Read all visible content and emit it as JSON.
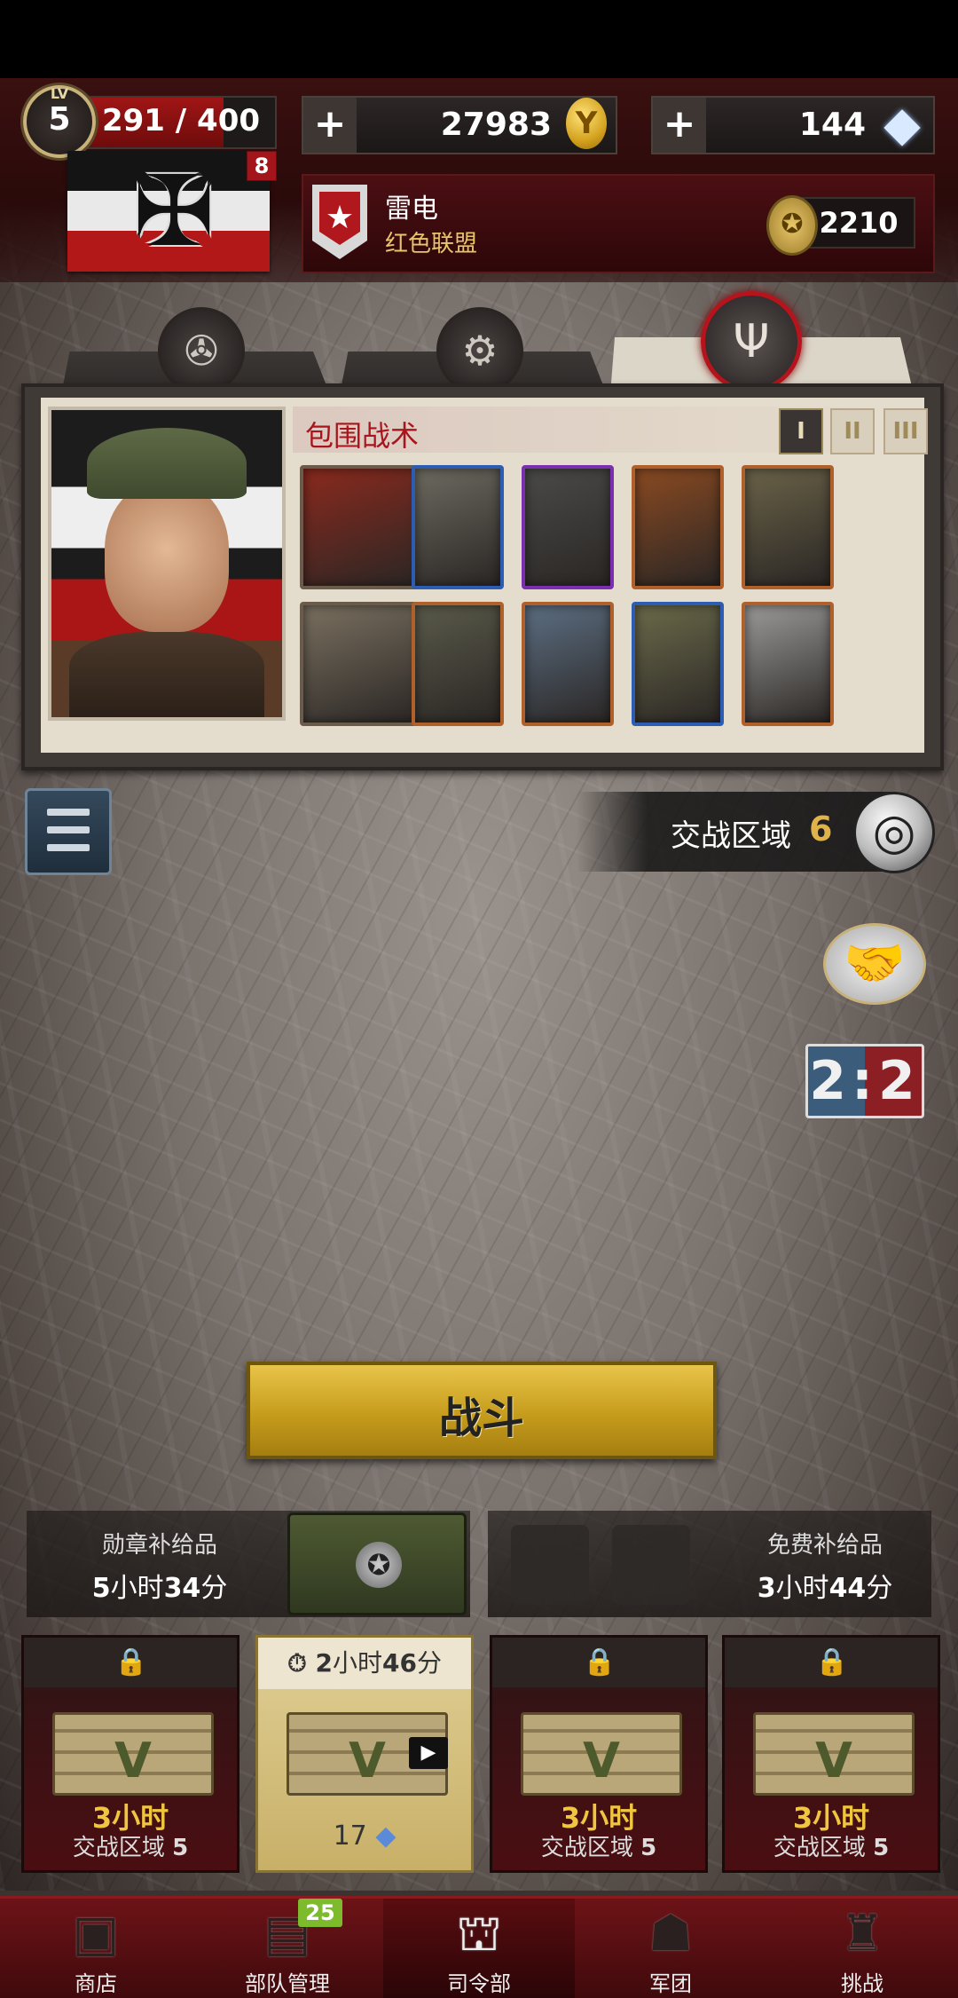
{
  "player": {
    "level_prefix": "LV",
    "level": "5",
    "xp_text": "291 / 400",
    "xp_fraction": 0.7275,
    "flag_badge": "8"
  },
  "currency": {
    "coins": "27983",
    "diamonds": "144",
    "plus": "+"
  },
  "alliance": {
    "player_name": "雷电",
    "alliance_name": "红色联盟",
    "score": "2210"
  },
  "tactic": {
    "title": "包围战术",
    "tiers": [
      "I",
      "II",
      "III"
    ],
    "active_tier": "I",
    "cards": [
      {
        "border": "#6b5b4a"
      },
      {
        "border": "#2d5db2"
      },
      {
        "border": "#7b2fb0"
      },
      {
        "border": "#b0602a"
      },
      {
        "border": "#b0602a"
      },
      {
        "border": "#6b5b4a"
      },
      {
        "border": "#b0602a"
      },
      {
        "border": "#b0602a"
      },
      {
        "border": "#2d5db2"
      },
      {
        "border": "#b0602a"
      }
    ]
  },
  "zone": {
    "label": "交战区域",
    "number": "6"
  },
  "vs": "2:2",
  "battle": {
    "label": "战斗"
  },
  "supplies": {
    "medal_title": "勋章补给品",
    "medal_hours": "5",
    "medal_minutes": "34",
    "free_title": "免费补给品",
    "free_hours": "3",
    "free_minutes": "44",
    "unit_hour": "小时",
    "unit_min": "分"
  },
  "chests": [
    {
      "time": "3",
      "unit": "小时",
      "zone_label": "交战区域",
      "zone": "5"
    },
    {
      "timer_h": "2",
      "timer_m": "46",
      "unit_h": "小时",
      "unit_m": "分",
      "cost": "17"
    },
    {
      "time": "3",
      "unit": "小时",
      "zone_label": "交战区域",
      "zone": "5"
    },
    {
      "time": "3",
      "unit": "小时",
      "zone_label": "交战区域",
      "zone": "5"
    }
  ],
  "nav": {
    "items": [
      {
        "label": "商店"
      },
      {
        "label": "部队管理",
        "badge": "25"
      },
      {
        "label": "司令部"
      },
      {
        "label": "军团"
      },
      {
        "label": "挑战"
      }
    ],
    "active_index": 2
  }
}
